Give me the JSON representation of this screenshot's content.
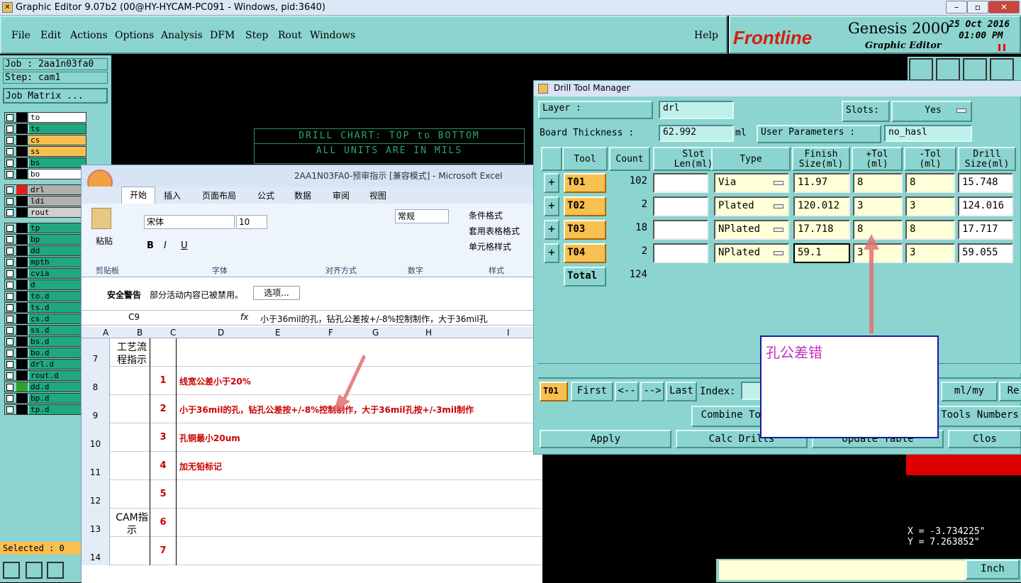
{
  "window": {
    "title": "Graphic Editor 9.07b2 (00@HY-HYCAM-PC091 - Windows, pid:3640)"
  },
  "menu": [
    "File",
    "Edit",
    "Actions",
    "Options",
    "Analysis",
    "DFM",
    "Step",
    "Rout",
    "Windows"
  ],
  "help": "Help",
  "brand": {
    "logo": "Frontline",
    "product": "Genesis 2000",
    "sub": "Graphic Editor",
    "date": "25 Oct 2016",
    "time": "01:00 PM"
  },
  "job": {
    "job": "Job : 2aa1n03fa0",
    "step": "Step: cam1",
    "matrix": "Job Matrix ..."
  },
  "layers": [
    {
      "name": "to",
      "color": "#ffffff"
    },
    {
      "name": "ts",
      "color": "#1fa87f"
    },
    {
      "name": "cs",
      "color": "#f8c050"
    },
    {
      "name": "ss",
      "color": "#f8c050"
    },
    {
      "name": "bs",
      "color": "#1fa87f"
    },
    {
      "name": "bo",
      "color": "#ffffff"
    },
    {
      "name": "drl",
      "color": "#b0b0b0",
      "swatch": "#e02020"
    },
    {
      "name": "ldi",
      "color": "#b0b0b0"
    },
    {
      "name": "rout",
      "color": "#d0d0d0"
    },
    {
      "name": "tp",
      "color": "#1fa87f"
    },
    {
      "name": "bp",
      "color": "#1fa87f"
    },
    {
      "name": "dd",
      "color": "#1fa87f"
    },
    {
      "name": "mpth",
      "color": "#1fa87f"
    },
    {
      "name": "cvia",
      "color": "#1fa87f"
    },
    {
      "name": "d",
      "color": "#1fa87f"
    },
    {
      "name": "to.d",
      "color": "#1fa87f"
    },
    {
      "name": "ts.d",
      "color": "#1fa87f"
    },
    {
      "name": "cs.d",
      "color": "#1fa87f"
    },
    {
      "name": "ss.d",
      "color": "#1fa87f"
    },
    {
      "name": "bs.d",
      "color": "#1fa87f"
    },
    {
      "name": "bo.d",
      "color": "#1fa87f"
    },
    {
      "name": "drl.d",
      "color": "#1fa87f"
    },
    {
      "name": "rout.d",
      "color": "#1fa87f"
    },
    {
      "name": "dd.d",
      "color": "#1fa87f",
      "swatch": "#30a030"
    },
    {
      "name": "bp.d",
      "color": "#1fa87f"
    },
    {
      "name": "tp.d",
      "color": "#1fa87f"
    }
  ],
  "selected": "Selected : 0",
  "drill_chart": {
    "title": "DRILL CHART: TOP to BOTTOM",
    "units": "ALL UNITS ARE IN MILS"
  },
  "excel": {
    "title": "2AA1N03FA0-预审指示 [兼容模式] - Microsoft Excel",
    "tabs": [
      "开始",
      "插入",
      "页面布局",
      "公式",
      "数据",
      "审阅",
      "视图"
    ],
    "font": "宋体",
    "size": "10",
    "number_format": "常规",
    "groups": [
      "剪贴板",
      "字体",
      "对齐方式",
      "数字",
      "样式"
    ],
    "paste": "粘贴",
    "styles": [
      "条件格式",
      "套用表格格式",
      "单元格样式"
    ],
    "security": "安全警告",
    "security_msg": "部分活动内容已被禁用。",
    "options": "选项...",
    "cellref": "C9",
    "formula": "小于36mil的孔，钻孔公差按+/-8%控制制作，大于36mil孔",
    "cols": [
      "A",
      "B",
      "C",
      "D",
      "E",
      "F",
      "G",
      "H",
      "I"
    ],
    "rows": [
      {
        "n": "7",
        "a": "工艺流程指示",
        "b": "",
        "c": ""
      },
      {
        "n": "8",
        "a": "",
        "b": "1",
        "c": "线宽公差小于20%"
      },
      {
        "n": "9",
        "a": "",
        "b": "2",
        "c": "小于36mil的孔，钻孔公差按+/-8%控制制作，大于36mil孔按+/-3mil制作"
      },
      {
        "n": "10",
        "a": "",
        "b": "3",
        "c": "孔铜最小20um"
      },
      {
        "n": "11",
        "a": "",
        "b": "4",
        "c": "加无铅标记"
      },
      {
        "n": "12",
        "a": "",
        "b": "5",
        "c": ""
      },
      {
        "n": "13",
        "a": "CAM指示",
        "b": "6",
        "c": ""
      },
      {
        "n": "14",
        "a": "",
        "b": "7",
        "c": ""
      }
    ]
  },
  "dtm": {
    "title": "Drill Tool Manager",
    "layer_label": "Layer          :",
    "layer": "drl",
    "slots_label": "Slots:",
    "slots": "Yes",
    "thick_label": "Board Thickness :",
    "thick": "62.992",
    "thick_unit": "ml",
    "up_label": "User Parameters :",
    "up": "no_hasl",
    "headers": [
      "Tool",
      "Count",
      "Slot\nLen(ml)",
      "Type",
      "Finish\nSize(ml)",
      "+Tol\n(ml)",
      "-Tol\n(ml)",
      "Drill\nSize(ml)"
    ],
    "tools": [
      {
        "tool": "T01",
        "count": "102",
        "slot": "",
        "type": "Via",
        "finish": "11.97",
        "ptol": "8",
        "mtol": "8",
        "drill": "15.748"
      },
      {
        "tool": "T02",
        "count": "2",
        "slot": "",
        "type": "Plated",
        "finish": "120.012",
        "ptol": "3",
        "mtol": "3",
        "drill": "124.016"
      },
      {
        "tool": "T03",
        "count": "18",
        "slot": "",
        "type": "NPlated",
        "finish": "17.718",
        "ptol": "8",
        "mtol": "8",
        "drill": "17.717"
      },
      {
        "tool": "T04",
        "count": "2",
        "slot": "",
        "type": "NPlated",
        "finish": "59.1",
        "ptol": "3",
        "mtol": "3",
        "drill": "59.055"
      }
    ],
    "total_label": "Total",
    "total": "124",
    "nav_tool": "T01",
    "first": "First",
    "prev": "<--",
    "next": "-->",
    "last": "Last",
    "index": "Index:",
    "units": "ml/my",
    "re": "Re",
    "combine": "Combine Too",
    "tools_numbers": "Tools Numbers",
    "apply": "Apply",
    "calc": "Calc Drills",
    "update": "Update Table",
    "close": "Clos"
  },
  "annotation": "孔公差错",
  "coords": {
    "x": "X = -3.734225\"",
    "y": "Y = 7.263852\""
  },
  "unit": "Inch"
}
